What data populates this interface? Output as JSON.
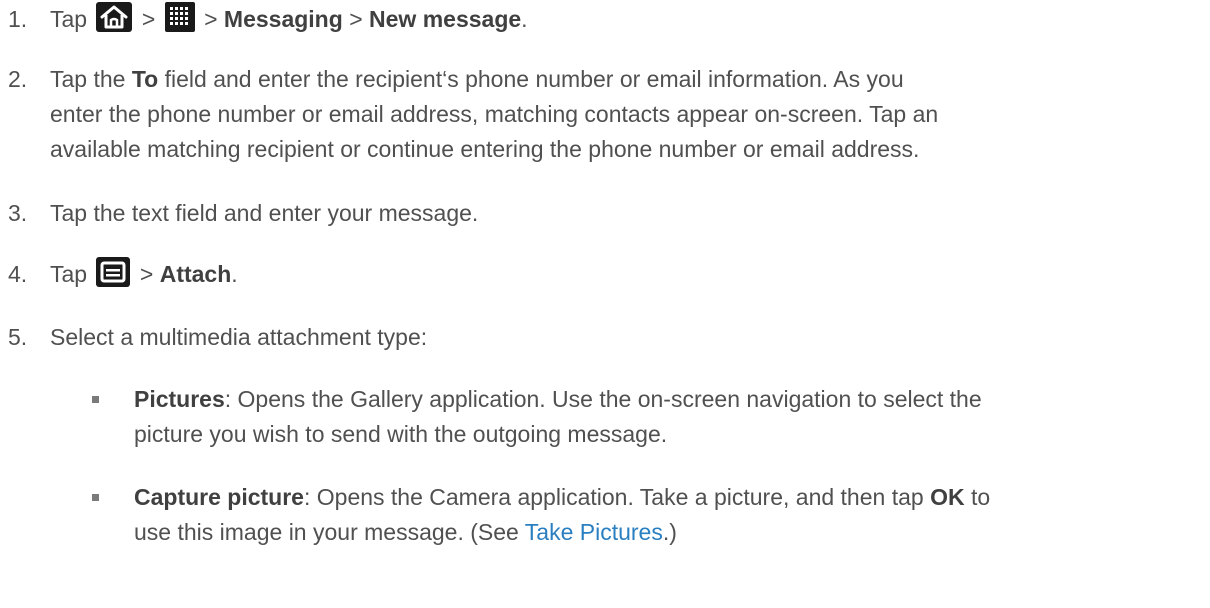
{
  "steps": [
    {
      "num": "1.",
      "prefix": "Tap",
      "sep1": ">",
      "sep2": ">",
      "messaging": "Messaging",
      "sep3": ">",
      "new_message": "New message",
      "end": ".",
      "icons": [
        "home-icon",
        "apps-grid-icon"
      ]
    },
    {
      "num": "2.",
      "part1": "Tap the ",
      "to": "To",
      "line1_rest": " field and enter the recipient‘s phone number or email information. As you",
      "line2": "enter the phone number or email address, matching contacts appear on-screen. Tap an",
      "line3": "available matching recipient or continue entering the phone number or email address."
    },
    {
      "num": "3.",
      "text": "Tap the text field and enter your message."
    },
    {
      "num": "4.",
      "prefix": "Tap",
      "sep": ">",
      "attach": "Attach",
      "end": ".",
      "icons": [
        "menu-icon"
      ]
    },
    {
      "num": "5.",
      "text": "Select a multimedia attachment type:"
    }
  ],
  "bullets": [
    {
      "term": "Pictures",
      "line1_rest": ": Opens the Gallery application. Use the on-screen navigation to select the",
      "line2": "picture you wish to send with the outgoing message."
    },
    {
      "term": "Capture picture",
      "line1_rest": ": Opens the Camera application. Take a picture, and then tap ",
      "ok": "OK",
      "line1_end": " to",
      "line2_pre": "use this image in your message. (See ",
      "link": "Take Pictures",
      "line2_post": ".)"
    }
  ],
  "colors": {
    "text": "#505050",
    "link": "#2a7fc1",
    "icon_bg": "#1a1a1a",
    "icon_fg": "#ffffff"
  }
}
